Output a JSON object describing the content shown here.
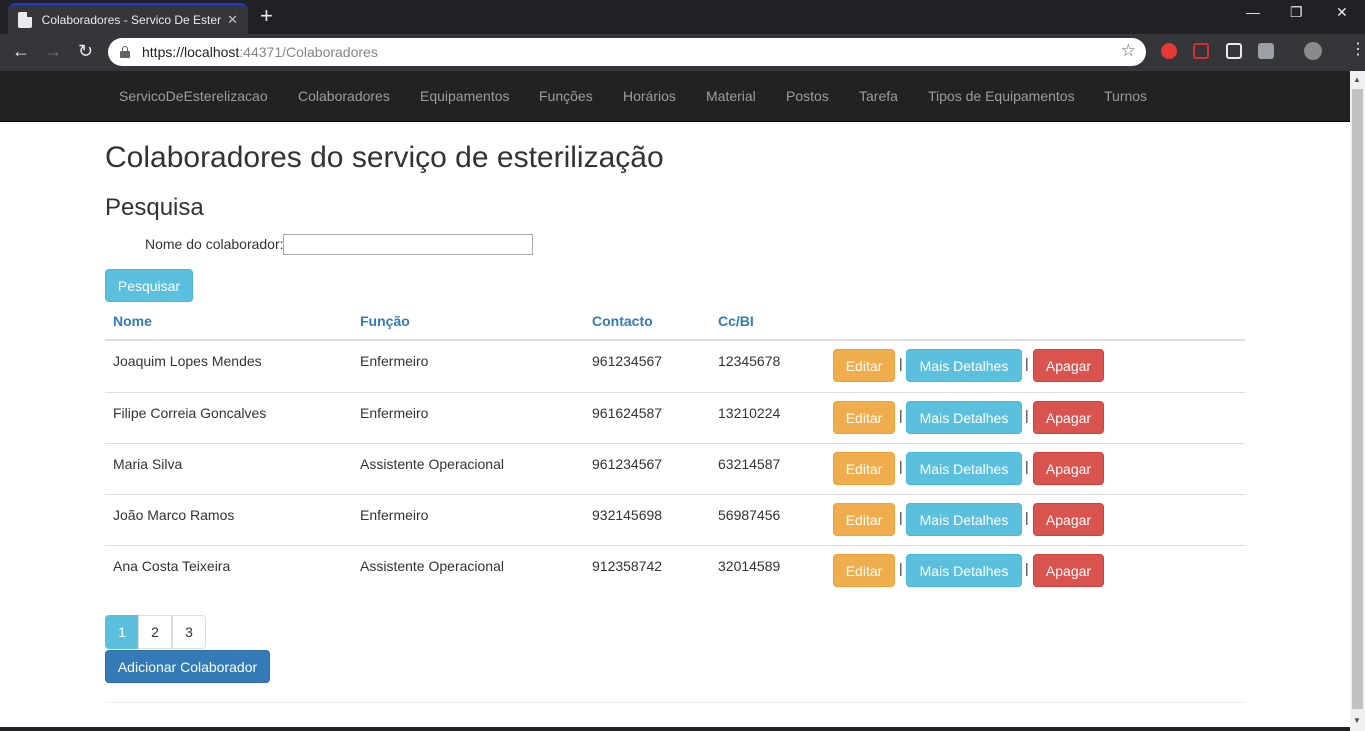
{
  "browser": {
    "tab_title": "Colaboradores - Servico De Esteriliz",
    "tab_close": "✕",
    "new_tab": "+",
    "window_min": "—",
    "window_restore": "❐",
    "window_close": "✕",
    "back": "←",
    "forward": "→",
    "reload": "↻",
    "url_scheme_host": "https://localhost",
    "url_rest": ":44371/Colaboradores",
    "star": "☆"
  },
  "navbar": {
    "brand": "ServicoDeEsterelizacao",
    "items": [
      "Colaboradores",
      "Equipamentos",
      "Funções",
      "Horários",
      "Material",
      "Postos",
      "Tarefa",
      "Tipos de Equipamentos",
      "Turnos"
    ]
  },
  "page": {
    "title": "Colaboradores do serviço de esterilização",
    "search_title": "Pesquisa",
    "search_label": "Nome do colaborador:",
    "search_value": "",
    "search_button": "Pesquisar"
  },
  "table": {
    "headers": [
      "Nome",
      "Função",
      "Contacto",
      "Cc/BI"
    ],
    "rows": [
      {
        "nome": "Joaquim Lopes Mendes",
        "funcao": "Enfermeiro",
        "contacto": "961234567",
        "cc": "12345678"
      },
      {
        "nome": "Filipe Correia Goncalves",
        "funcao": "Enfermeiro",
        "contacto": "961624587",
        "cc": "13210224"
      },
      {
        "nome": "Maria Silva",
        "funcao": "Assistente Operacional",
        "contacto": "961234567",
        "cc": "63214587"
      },
      {
        "nome": "João Marco Ramos",
        "funcao": "Enfermeiro",
        "contacto": "932145698",
        "cc": "56987456"
      },
      {
        "nome": "Ana Costa Teixeira",
        "funcao": "Assistente Operacional",
        "contacto": "912358742",
        "cc": "32014589"
      }
    ],
    "actions": {
      "edit": "Editar",
      "details": "Mais Detalhes",
      "delete": "Apagar",
      "separator": "|"
    }
  },
  "pagination": {
    "pages": [
      "1",
      "2",
      "3"
    ],
    "current": "1"
  },
  "add_button": "Adicionar Colaborador"
}
